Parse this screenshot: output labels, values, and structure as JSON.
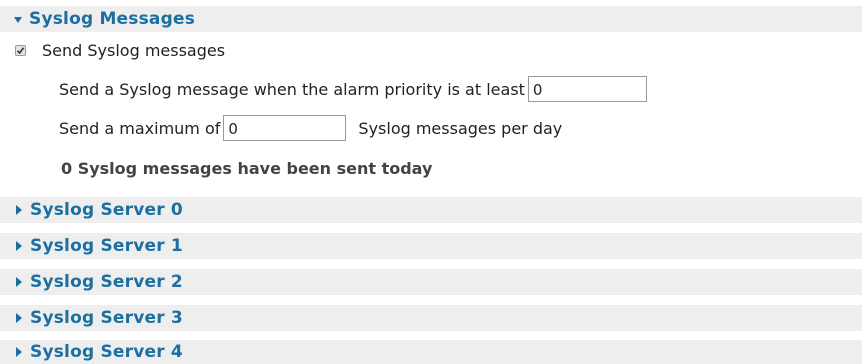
{
  "syslog_messages": {
    "title": "Syslog Messages",
    "send_checkbox": {
      "label": "Send Syslog messages",
      "checked": true
    },
    "priority_label": "Send a Syslog message when the alarm priority is at least",
    "priority_value": "0",
    "max_prefix": "Send a maximum of",
    "max_value": "0",
    "max_suffix": "Syslog messages per day",
    "status": "0 Syslog messages have been sent today"
  },
  "servers": [
    {
      "label": "Syslog Server 0"
    },
    {
      "label": "Syslog Server 1"
    },
    {
      "label": "Syslog Server 2"
    },
    {
      "label": "Syslog Server 3"
    },
    {
      "label": "Syslog Server 4"
    }
  ],
  "colors": {
    "header_text": "#1c6fa0",
    "header_bg": "#eeeeee"
  }
}
